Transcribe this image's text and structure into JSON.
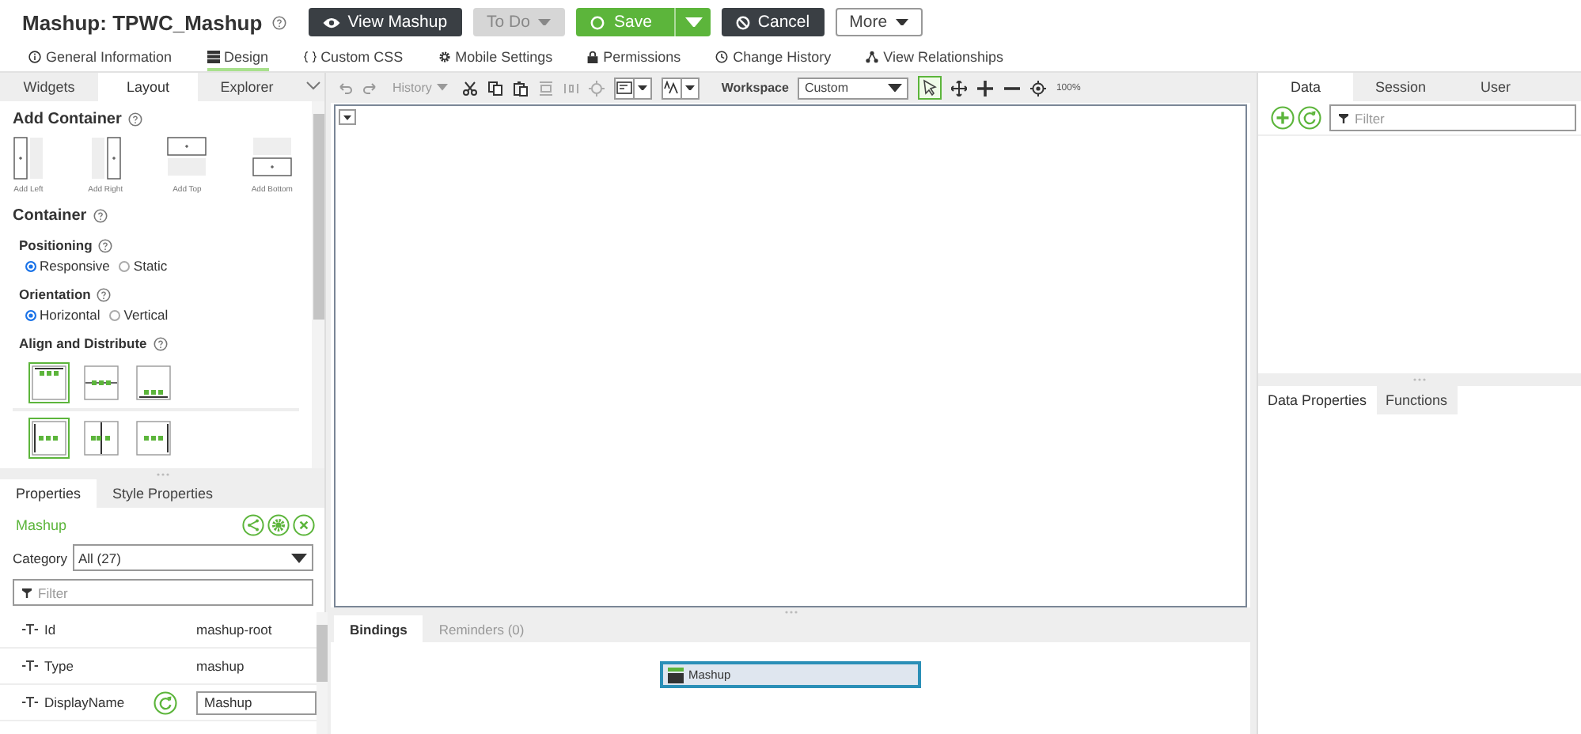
{
  "header": {
    "label": "Mashup:",
    "name": "TPWC_Mashup",
    "buttons": [
      {
        "label": "View Mashup",
        "kind": "view"
      },
      {
        "label": "To Do",
        "kind": "todo"
      },
      {
        "label": "Save",
        "kind": "save"
      },
      {
        "label": "Cancel",
        "kind": "cancel"
      },
      {
        "label": "More",
        "kind": "more"
      }
    ]
  },
  "nav_tabs": [
    {
      "label": "General Information",
      "kind": "info",
      "selected": false
    },
    {
      "label": "Design",
      "kind": "design",
      "selected": true
    },
    {
      "label": "Custom CSS",
      "kind": "css",
      "selected": false
    },
    {
      "label": "Mobile Settings",
      "kind": "mobile",
      "selected": false
    },
    {
      "label": "Permissions",
      "kind": "permissions",
      "selected": false
    },
    {
      "label": "Change History",
      "kind": "history",
      "selected": false
    },
    {
      "label": "View Relationships",
      "kind": "relationships",
      "selected": false
    }
  ],
  "left_tabs": [
    {
      "label": "Widgets",
      "selected": false
    },
    {
      "label": "Layout",
      "selected": true
    },
    {
      "label": "Explorer",
      "selected": false
    }
  ],
  "add_container": {
    "title": "Add Container",
    "options": [
      {
        "label": "Add Left",
        "kind": "left"
      },
      {
        "label": "Add Right",
        "kind": "right"
      },
      {
        "label": "Add Top",
        "kind": "top"
      },
      {
        "label": "Add Bottom",
        "kind": "bottom"
      }
    ]
  },
  "container": {
    "title": "Container",
    "positioning": {
      "label": "Positioning",
      "options": [
        {
          "label": "Responsive",
          "selected": true
        },
        {
          "label": "Static",
          "selected": false
        }
      ]
    },
    "orientation": {
      "label": "Orientation",
      "options": [
        {
          "label": "Horizontal",
          "selected": true
        },
        {
          "label": "Vertical",
          "selected": false
        }
      ]
    },
    "align": {
      "label": "Align and Distribute",
      "options": [
        {
          "kind": "top",
          "selected": true
        },
        {
          "kind": "middle",
          "selected": false
        },
        {
          "kind": "bottom",
          "selected": false
        },
        {
          "kind": "left",
          "selected": true
        },
        {
          "kind": "center",
          "selected": false
        },
        {
          "kind": "right",
          "selected": false
        }
      ]
    }
  },
  "properties": {
    "tabs": [
      {
        "label": "Properties",
        "selected": true
      },
      {
        "label": "Style Properties",
        "selected": false
      }
    ],
    "selected_item": "Mashup",
    "category": {
      "label": "Category",
      "value": "All (27)"
    },
    "filter": {
      "placeholder": "Filter"
    },
    "rows": [
      {
        "name": "Id",
        "kind": "text",
        "value": "mashup-root"
      },
      {
        "name": "Type",
        "kind": "text",
        "value": "mashup"
      },
      {
        "name": "DisplayName",
        "kind": "input",
        "value": "Mashup"
      }
    ]
  },
  "toolbar": {
    "history": "History",
    "workspace": {
      "label": "Workspace",
      "value": "Custom"
    },
    "zoom": "100%"
  },
  "bottom_tabs": [
    {
      "label": "Bindings",
      "selected": true
    },
    {
      "label": "Reminders (0)",
      "selected": false
    }
  ],
  "binding_node": "Mashup",
  "right_tabs": [
    {
      "label": "Data",
      "selected": true
    },
    {
      "label": "Session",
      "selected": false
    },
    {
      "label": "User",
      "selected": false
    }
  ],
  "data_filter": {
    "placeholder": "Filter"
  },
  "right_bottom_tabs": [
    {
      "label": "Data Properties",
      "selected": true
    },
    {
      "label": "Functions",
      "selected": false
    }
  ]
}
